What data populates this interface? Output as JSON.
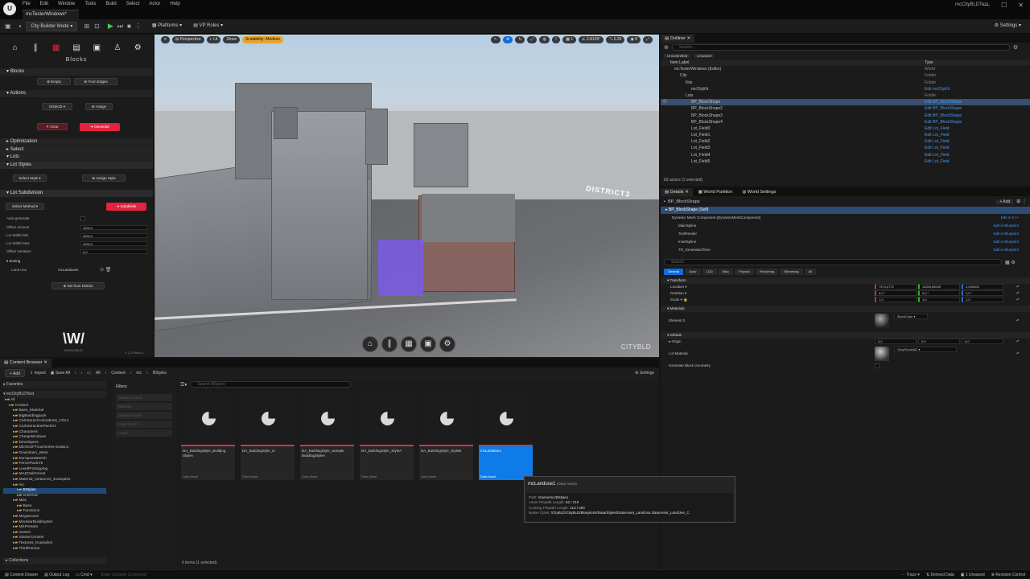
{
  "app": {
    "title": "mcCityBLDTest",
    "tab": "mcTesterWindows*"
  },
  "menu": [
    "File",
    "Edit",
    "Window",
    "Tools",
    "Build",
    "Select",
    "Actor",
    "Help"
  ],
  "toolbar": {
    "mode": "City Builder Mode",
    "platforms": "Platforms",
    "vp_roles": "VP Roles",
    "settings": "Settings"
  },
  "left_panel": {
    "title": "Blocks",
    "blocks_header": "Blocks",
    "empty": "Empty",
    "from_edges": "From Edges",
    "actions_header": "Actions",
    "district_value": "District2",
    "assign": "Assign",
    "clear": "Clear",
    "generate": "Generate",
    "optimization": "Optimization",
    "select": "Select",
    "lots": "Lots",
    "lot_styles": "Lot Styles",
    "select_style": "Select Style",
    "assign_style": "Assign Style",
    "lot_subdivision": "Lot Subdivision",
    "select_method": "Select Method",
    "subdivide": "Subdivide",
    "fields": [
      {
        "label": "Auto-generate",
        "value": ""
      },
      {
        "label": "Offset Amount",
        "value": "1000,0"
      },
      {
        "label": "Lot Width Min",
        "value": "3000,0"
      },
      {
        "label": "Lot Width Max",
        "value": "2000,0"
      },
      {
        "label": "Offset Variation",
        "value": "0,0"
      }
    ],
    "zoning": "Zoning",
    "land_use_label": "Land Use",
    "land_use_value": "mcLanduses",
    "set_from_district": "Set from District",
    "brand": "WORLDBLD",
    "version": "0.1.3 Patch 4"
  },
  "viewport": {
    "perspective": "Perspective",
    "lit": "Lit",
    "show": "Show",
    "scalability": "Scalability: Medium",
    "snap1": "1",
    "snap2": "2.8125°",
    "snap3": "0.25",
    "snap4": "8",
    "district_label": "DISTRICT3",
    "brand": "CITYBLD"
  },
  "outliner": {
    "tab": "Outliner",
    "search_placeholder": "Search...",
    "tab_unc": "Unsaved",
    "filter_unc": "Uncontrolled",
    "filter_uns": "Unsaved",
    "col_label": "Item Label",
    "col_type": "Type",
    "rows": [
      {
        "name": "mcTesterWindows (Editor)",
        "type": "World",
        "indent": 1,
        "link": false
      },
      {
        "name": "City",
        "type": "Folder",
        "indent": 2,
        "link": false
      },
      {
        "name": "Kits",
        "type": "Folder",
        "indent": 3,
        "link": false
      },
      {
        "name": "mcCityKit",
        "type": "Edit mcCityKit",
        "indent": 4,
        "link": true
      },
      {
        "name": "Lots",
        "type": "Folder",
        "indent": 3,
        "link": false
      },
      {
        "name": "BP_BlockShape",
        "type": "Edit BP_BlockShape",
        "indent": 4,
        "link": true,
        "sel": true
      },
      {
        "name": "BP_BlockShape2",
        "type": "Edit BP_BlockShape",
        "indent": 4,
        "link": true
      },
      {
        "name": "BP_BlockShape3",
        "type": "Edit BP_BlockShape",
        "indent": 4,
        "link": true
      },
      {
        "name": "BP_BlockShape4",
        "type": "Edit BP_BlockShape",
        "indent": 4,
        "link": true
      },
      {
        "name": "Lot_Field0",
        "type": "Edit Lot_Field",
        "indent": 4,
        "link": true
      },
      {
        "name": "Lot_Field1",
        "type": "Edit Lot_Field",
        "indent": 4,
        "link": true
      },
      {
        "name": "Lot_Field2",
        "type": "Edit Lot_Field",
        "indent": 4,
        "link": true
      },
      {
        "name": "Lot_Field3",
        "type": "Edit Lot_Field",
        "indent": 4,
        "link": true
      },
      {
        "name": "Lot_Field4",
        "type": "Edit Lot_Field",
        "indent": 4,
        "link": true
      },
      {
        "name": "Lot_Field5",
        "type": "Edit Lot_Field",
        "indent": 4,
        "link": true
      }
    ],
    "status": "63 actors (1 selected)"
  },
  "details": {
    "tabs": [
      "Details",
      "World Partition",
      "World Settings"
    ],
    "actor": "BP_BlockShape",
    "add": "Add",
    "self": "BP_BlockShape (Self)",
    "components": [
      {
        "name": "Dynamic Mesh Component (DynamicMeshComponent)",
        "action": "Edit in C++"
      },
      {
        "name": "MainSpline",
        "action": "Edit in Blueprint"
      },
      {
        "name": "TextRender",
        "action": "Edit in Blueprint"
      },
      {
        "name": "InsetSpline",
        "action": "Edit in Blueprint"
      },
      {
        "name": "TR_GeneratedTime",
        "action": "Edit in Blueprint"
      }
    ],
    "search_placeholder": "Search",
    "filters": [
      "General",
      "Actor",
      "LOD",
      "Misc",
      "Physics",
      "Rendering",
      "Streaming",
      "All"
    ],
    "transform": "Transform",
    "location": {
      "label": "Location",
      "x": "7973,0772",
      "y": "11055,69009",
      "z": "0,000005"
    },
    "rotation": {
      "label": "Rotation",
      "x": "0,0 °",
      "y": "0,0 °",
      "z": "0,0 °"
    },
    "scale": {
      "label": "Scale",
      "x": "1,0",
      "y": "1,0",
      "z": "1,0"
    },
    "materials": "Materials",
    "element0": "Element 0",
    "element0_value": "BlockCube",
    "default": "Default",
    "origin": "Origin",
    "origin_x": "0,0",
    "origin_y": "0,0",
    "origin_z": "0,0",
    "lot_material": "Lot Material",
    "lot_material_value": "GreyStuckAll2",
    "gen_block": "Generate Block Geometry"
  },
  "content_browser": {
    "tab": "Content Browser",
    "add": "Add",
    "import": "Import",
    "save_all": "Save All",
    "path": [
      "All",
      "Content",
      "mc",
      "BStyles"
    ],
    "settings": "Settings",
    "favorites": "Favorites",
    "project": "mcCityBLDTest",
    "search_placeholder": "Search BStyles",
    "filters_title": "Filters",
    "filter_items": [
      "Blueprint Class",
      "Material",
      "Skeletal Mesh",
      "Static Mesh",
      "Level"
    ],
    "tree": [
      {
        "name": "All",
        "indent": 0
      },
      {
        "name": "Content",
        "indent": 1
      },
      {
        "name": "Base_Material",
        "indent": 2
      },
      {
        "name": "BigBuildingpack",
        "indent": 2
      },
      {
        "name": "CarInteractAnimations_VOL1",
        "indent": 2
      },
      {
        "name": "CarInteractionPackV1",
        "indent": 2
      },
      {
        "name": "Characters",
        "indent": 2
      },
      {
        "name": "CheapWindows",
        "indent": 2
      },
      {
        "name": "Developers",
        "indent": 2
      },
      {
        "name": "DEXSOFTCarSeries-Sedan1",
        "indent": 2
      },
      {
        "name": "Downtown_West",
        "indent": 2
      },
      {
        "name": "EuropeanBeech",
        "indent": 2
      },
      {
        "name": "FencePackV5",
        "indent": 2
      },
      {
        "name": "LevelPrototyping",
        "indent": 2
      },
      {
        "name": "MAEOakForest",
        "indent": 2
      },
      {
        "name": "Material_Instances_Examples",
        "indent": 2
      },
      {
        "name": "mc",
        "indent": 2
      },
      {
        "name": "BStyles",
        "indent": 3,
        "sel": true
      },
      {
        "name": "enterCar",
        "indent": 3
      },
      {
        "name": "MDL",
        "indent": 2
      },
      {
        "name": "Base",
        "indent": 3
      },
      {
        "name": "Functions",
        "indent": 3
      },
      {
        "name": "Megascans",
        "indent": 2
      },
      {
        "name": "ModularBuildingSet",
        "indent": 2
      },
      {
        "name": "MSPresets",
        "indent": 2
      },
      {
        "name": "newKit",
        "indent": 2
      },
      {
        "name": "StarterContent",
        "indent": 2
      },
      {
        "name": "Textures_Examples",
        "indent": 2
      },
      {
        "name": "ThirdPerson",
        "indent": 2
      }
    ],
    "assets": [
      {
        "name": "DA_BuildingStyle_Building StyleA",
        "kind": "Data Asset"
      },
      {
        "name": "DA_BuildingStyle_D",
        "kind": "Data Asset"
      },
      {
        "name": "DA_BuildingStyle_Sample BuildingStyleA",
        "kind": "Data Asset"
      },
      {
        "name": "DA_BuildingStyle_StyleA",
        "kind": "Data Asset"
      },
      {
        "name": "DA_BuildingStyle_StyleB",
        "kind": "Data Asset"
      },
      {
        "name": "mcLanduse1",
        "kind": "Data Asset",
        "sel": true
      }
    ],
    "collections": "Collections",
    "count": "6 items (1 selected)"
  },
  "tooltip": {
    "title": "mcLanduse1",
    "kind": "(Data Asset)",
    "path_label": "Path:",
    "path": "/Game/mc/BStyles",
    "len_label": "Asset Filepath Length:",
    "len": "62 / 210",
    "cook_label": "Cooking Filepath Length:",
    "cook": "113 / 260",
    "native_label": "Native Class:",
    "native": "/CityBLD/CityBLD/Blueprints/Data/Styles/DataAsset_LandUse.DataAsset_LandUse_C"
  },
  "statusbar": {
    "drawer": "Content Drawer",
    "output": "Output Log",
    "cmd": "Cmd",
    "console_placeholder": "Enter Console Command",
    "trace": "Trace",
    "derived": "Derived Data",
    "unsaved": "1 Unsaved",
    "revision": "Revision Control"
  },
  "colors": {
    "accent_red": "#e4233f",
    "selection_blue": "#0f7be8",
    "link_blue": "#4a9ae8"
  }
}
